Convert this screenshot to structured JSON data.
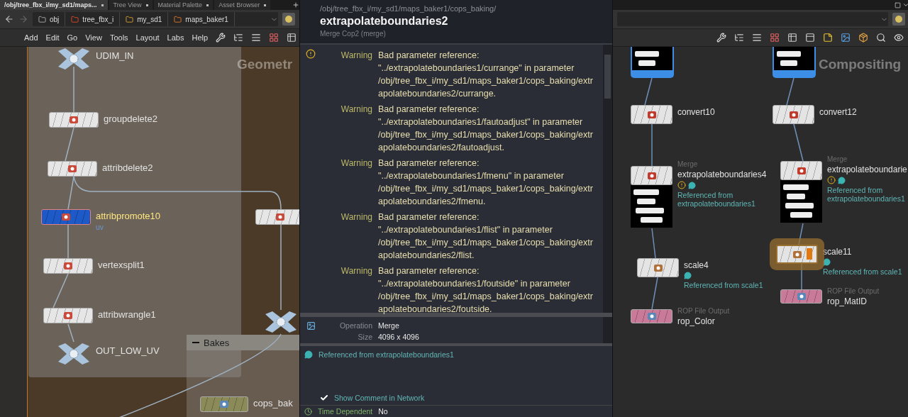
{
  "left_pane": {
    "tabs": [
      {
        "label": "/obj/tree_fbx_i/my_sd1/maps...",
        "selected": true
      },
      {
        "label": "Tree View",
        "selected": false
      },
      {
        "label": "Material Palette",
        "selected": false
      },
      {
        "label": "Asset Browser",
        "selected": false
      }
    ],
    "path": [
      "obj",
      "tree_fbx_i",
      "my_sd1",
      "maps_baker1"
    ],
    "menu": [
      "Add",
      "Edit",
      "Go",
      "View",
      "Tools",
      "Layout",
      "Labs",
      "Help"
    ],
    "network_box_title": "Geometr",
    "sub_box_title": "Bakes",
    "nodes": [
      {
        "kind": "null",
        "name": "UDIM_IN",
        "selected": false
      },
      {
        "kind": "sop",
        "name": "groupdelete2",
        "selected": false
      },
      {
        "kind": "sop",
        "name": "attribdelete2",
        "selected": false
      },
      {
        "kind": "sop",
        "name": "attribpromote10",
        "selected": true,
        "comment": "uv"
      },
      {
        "kind": "sop",
        "name": "vertexsplit1",
        "selected": false
      },
      {
        "kind": "sop",
        "name": "attribwrangle1",
        "selected": false
      },
      {
        "kind": "null",
        "name": "OUT_LOW_UV",
        "selected": false
      },
      {
        "kind": "sop",
        "selected": false
      },
      {
        "kind": "null",
        "selected": false
      },
      {
        "kind": "subnet",
        "name": "cops_bak",
        "selected": false
      }
    ]
  },
  "info_popup": {
    "path": "/obj/tree_fbx_i/my_sd1/maps_baker1/cops_baking/",
    "title": "extrapolateboundaries2",
    "type": "Merge Cop2 (merge)",
    "messages": [
      {
        "level": "Warning",
        "text": "Bad parameter reference: \"../extrapolateboundaries1/currange\" in parameter /obj/tree_fbx_i/my_sd1/maps_baker1/cops_baking/extrapolateboundaries2/currange."
      },
      {
        "level": "Warning",
        "text": "Bad parameter reference: \"../extrapolateboundaries1/fautoadjust\" in parameter /obj/tree_fbx_i/my_sd1/maps_baker1/cops_baking/extrapolateboundaries2/fautoadjust."
      },
      {
        "level": "Warning",
        "text": "Bad parameter reference: \"../extrapolateboundaries1/fmenu\" in parameter /obj/tree_fbx_i/my_sd1/maps_baker1/cops_baking/extrapolateboundaries2/fmenu."
      },
      {
        "level": "Warning",
        "text": "Bad parameter reference: \"../extrapolateboundaries1/flist\" in parameter /obj/tree_fbx_i/my_sd1/maps_baker1/cops_baking/extrapolateboundaries2/flist."
      },
      {
        "level": "Warning",
        "text": "Bad parameter reference: \"../extrapolateboundaries1/foutside\" in parameter /obj/tree_fbx_i/my_sd1/maps_baker1/cops_baking/extrapolateboundaries2/foutside."
      }
    ],
    "info": [
      {
        "label": "Operation",
        "value": "Merge"
      },
      {
        "label": "Size",
        "value": "4096 x 4096"
      }
    ],
    "comment": "Referenced from extrapolateboundaries1",
    "show_comment": {
      "label": "Show Comment in Network",
      "checked": true
    },
    "time_dependent": {
      "label": "Time Dependent",
      "value": "No"
    }
  },
  "right_pane": {
    "network_box_title": "Compositing",
    "nodes": [
      {
        "kind": "image",
        "selected": true,
        "highlighted": false
      },
      {
        "kind": "image",
        "selected": true,
        "highlighted": false
      },
      {
        "kind": "convert",
        "name": "convert10",
        "selected": false,
        "highlighted": false
      },
      {
        "kind": "convert",
        "name": "convert12",
        "selected": false,
        "highlighted": false
      },
      {
        "kind": "merge",
        "type": "Merge",
        "name": "extrapolateboundaries4",
        "warning": true,
        "comment": "Referenced from extrapolateboundaries1",
        "selected": false,
        "highlighted": false
      },
      {
        "kind": "merge",
        "type": "Merge",
        "name": "extrapolateboundarie",
        "warning": true,
        "comment": "Referenced from extrapolateboundaries1",
        "selected": false,
        "highlighted": false
      },
      {
        "kind": "scale",
        "name": "scale4",
        "comment": "Referenced from scale1",
        "selected": false,
        "highlighted": false
      },
      {
        "kind": "scale",
        "name": "scale11",
        "comment": "Referenced from scale1",
        "selected": false,
        "highlighted": true
      },
      {
        "kind": "rop",
        "type": "ROP File Output",
        "name": "rop_Color",
        "selected": false,
        "highlighted": false
      },
      {
        "kind": "rop",
        "type": "ROP File Output",
        "name": "rop_MatID",
        "selected": false,
        "highlighted": false
      }
    ]
  }
}
